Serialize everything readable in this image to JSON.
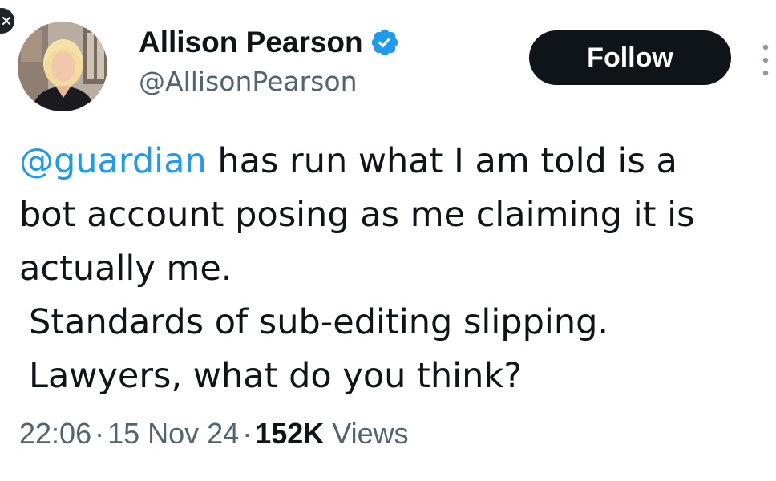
{
  "close": {
    "icon": "close-icon"
  },
  "author": {
    "display_name": "Allison Pearson",
    "handle": "@AllisonPearson",
    "verified_icon": "verified-badge-icon",
    "avatar_icon": "avatar"
  },
  "follow_label": "Follow",
  "more_icon": "more-vertical-icon",
  "tweet": {
    "mention": "@guardian",
    "line1_rest": " has run what I am told is a",
    "line2": "bot account posing as me claiming it is",
    "line3": "actually me.",
    "line4": "Standards of sub-editing slipping.",
    "line5": "Lawyers, what do you think?"
  },
  "meta": {
    "time": "22:06",
    "separator": "·",
    "date": "15 Nov 24",
    "views_count": "152K",
    "views_label": "Views"
  },
  "colors": {
    "accent": "#1d9bf0",
    "text": "#0f1419",
    "secondary": "#536471",
    "button_bg": "#0f1419"
  }
}
